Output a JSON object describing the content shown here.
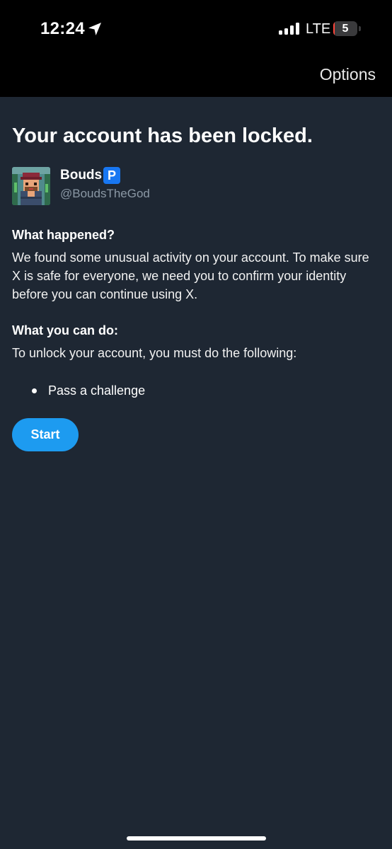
{
  "status_bar": {
    "time": "12:24",
    "network": "LTE",
    "battery_level": "5",
    "battery_fraction": 0.05
  },
  "header": {
    "options_label": "Options"
  },
  "title": "Your account has been locked.",
  "profile": {
    "display_name": "Bouds",
    "badge": "P",
    "username": "@BoudsTheGod"
  },
  "what_happened": {
    "heading": "What happened?",
    "body": "We found some unusual activity on your account. To make sure X is safe for everyone, we need you to confirm your identity before you can continue using X."
  },
  "what_you_can_do": {
    "heading": "What you can do:",
    "body": "To unlock your account, you must do the following:",
    "steps": [
      "Pass a challenge"
    ]
  },
  "start_label": "Start",
  "icons": {
    "location": "location-arrow-icon",
    "signal": "cellular-signal-icon",
    "battery": "battery-icon",
    "badge": "parking-badge-icon"
  },
  "colors": {
    "background": "#1e2733",
    "top_bar": "#000000",
    "accent": "#1d9bf0",
    "secondary_text": "#8b98a5",
    "battery_low": "#ff453a"
  }
}
